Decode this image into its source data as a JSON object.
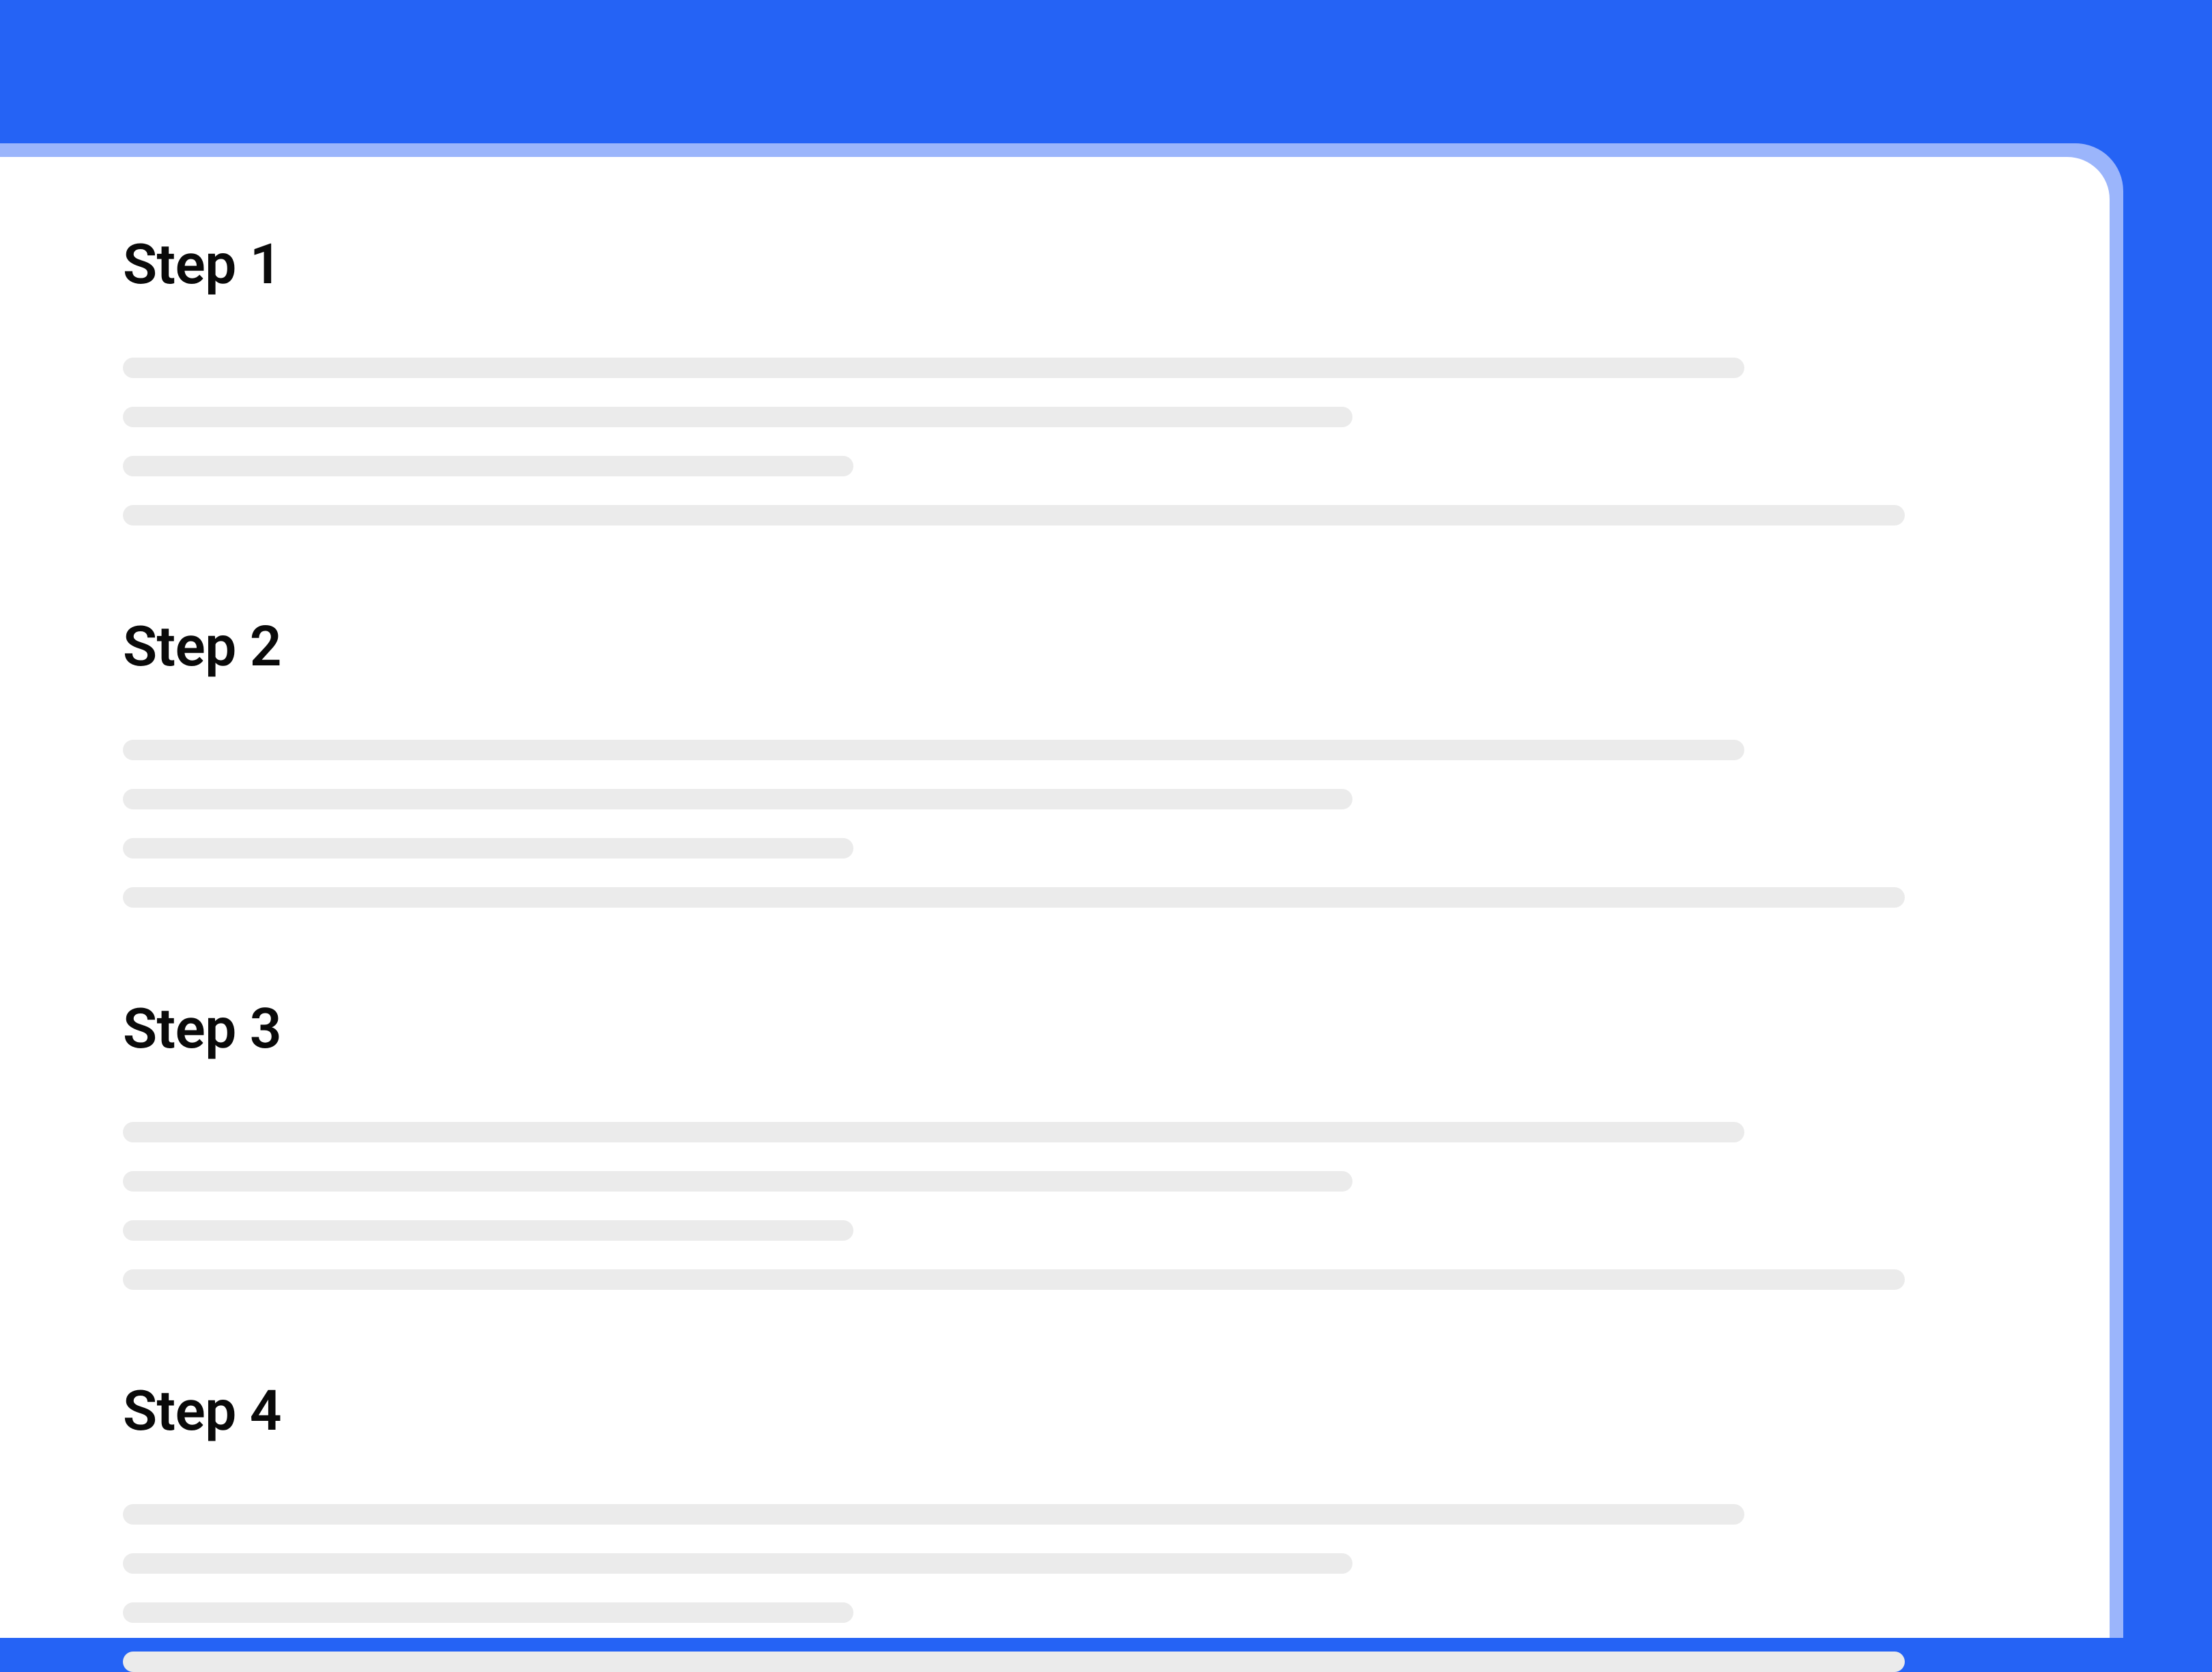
{
  "colors": {
    "background": "#2563F5",
    "card_border": "#9BB5FB",
    "card_bg": "#FFFFFF",
    "placeholder": "#EBEBEB",
    "text": "#0A0A0A"
  },
  "steps": [
    {
      "title": "Step 1"
    },
    {
      "title": "Step 2"
    },
    {
      "title": "Step 3"
    },
    {
      "title": "Step 4"
    }
  ]
}
